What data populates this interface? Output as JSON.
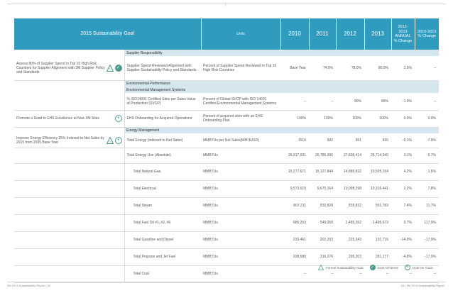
{
  "header": {
    "goal": "2015 Sustainability Goal",
    "units": "Units",
    "y2010": "2010",
    "y2011": "2011",
    "y2012": "2012",
    "y2013": "2013",
    "change1": "2012-2013 ANNUAL % Change",
    "change2": "2010-2013 % Change"
  },
  "sections": {
    "supplier": "Supplier Responsibility",
    "env": "Environmental Performance",
    "envsys": "Environmental Management Systems",
    "energy": "Energy Management"
  },
  "rows": {
    "r1": {
      "goal": "Assess 80% of Supplier Spend in Top 10 High Risk Countries for Supplier Alignment with 3M Supplier Policy and Standards",
      "metric": "Supplier Spend Reviewed Alignment with Supplier Sustainability Policy and Standards",
      "units": "Percent of Supplier Spend Reviewed in Top 10 High Risk Countries",
      "v2010": "Base Year",
      "v2011": "74.0%",
      "v2012": "78.0%",
      "v2013": "80.0%",
      "c1": "2.6%",
      "c2": "–"
    },
    "r2": {
      "metric": "% ISO14001 Certified Sites per Sales Value of Production (SVOP)",
      "units": "Percent of Global SVOP with ISO 14001 Certified Environmental Management Systems",
      "v2010": "–",
      "v2011": "–",
      "v2012": "90%",
      "v2013": "89%",
      "c1": "-1.0%",
      "c2": "–"
    },
    "r3": {
      "goal": "Promote a Road to EHS Excellence at New 3M Sites",
      "metric": "EHS Onboarding for Acquired Operations",
      "units": "Percent of acquired sites with an EHS Onboarding Plan",
      "v2010": "100%",
      "v2011": "100%",
      "v2012": "100%",
      "v2013": "100%",
      "c1": "0.0%",
      "c2": "0.0%"
    },
    "r4": {
      "goal": "Improve Energy Efficiency 25% Indexed to Net Sales by 2015 from 2005 Base Year",
      "metric": "Total Energy (Indexed to Net Sales)",
      "units": "MMBTUs per Net Sales(MM $USD)",
      "v2010": "1510",
      "v2011": "992",
      "v2012": "951",
      "v2013": "930",
      "c1": "-0.1%",
      "c2": "-7.9%"
    },
    "r5": {
      "metric": "Total Energy Use (Absolute)",
      "units": "MMBTUs",
      "v2010": "26,917,031",
      "v2011": "26,785,396",
      "v2012": "27,838,414",
      "v2013": "26,714,940",
      "c1": "3.1%",
      "c2": "6.7%"
    },
    "r6": {
      "metric": "Total Natural Gas",
      "units": "MMBTUs",
      "v2010": "15,277,671",
      "v2011": "15,127,844",
      "v2012": "14,885,822",
      "v2013": "15,505,194",
      "c1": "4.2%",
      "c2": "1.5%"
    },
    "r7": {
      "metric": "Total Electrical",
      "units": "MMBTUs",
      "v2010": "9,573,615",
      "v2011": "9,675,164",
      "v2012": "10,098,298",
      "v2013": "10,316,441",
      "c1": "2.2%",
      "c2": "7.8%"
    },
    "r8": {
      "metric": "Total Steam",
      "units": "MMBTUs",
      "v2010": "807,211",
      "v2011": "832,820",
      "v2012": "839,832",
      "v2013": "901,783",
      "c1": "7.4%",
      "c2": "11.7%"
    },
    "r9": {
      "metric": "Total Fuel Oil #1, #2, #6",
      "units": "MMBTUs",
      "v2010": "686,293",
      "v2011": "549,059",
      "v2012": "1,485,352",
      "v2013": "1,495,673",
      "c1": "0.7%",
      "c2": "117.9%"
    },
    "r10": {
      "metric": "Total Gasoline and Diesel",
      "units": "MMBTUs",
      "v2010": "233,461",
      "v2011": "202,203",
      "v2012": "225,343",
      "v2013": "191,715",
      "c1": "-14.9%",
      "c2": "-17.9%"
    },
    "r11": {
      "metric": "Total Propane and Jet Fuel",
      "units": "MMBTUs",
      "v2010": "338,680",
      "v2011": "316,276",
      "v2012": "295,203",
      "v2013": "281,177",
      "c1": "-4.8%",
      "c2": "-17.0%"
    },
    "r12": {
      "metric": "Total Coal",
      "units": "MMBTUs",
      "v2010": "–",
      "v2011": "–",
      "v2012": "–",
      "v2013": "–",
      "c1": "–",
      "c2": "–"
    }
  },
  "legend": {
    "formal": "Formal Sustainability Goal",
    "achieved": "Goal Achieved",
    "ontrack": "Goal On Track"
  },
  "footer": {
    "left": "3M 2013 Sustainability Report  |  32",
    "right": "33  |  3M 2013 Sustainability Report"
  },
  "colors": {
    "header": "#2f9bbf",
    "section": "#d5e6ee",
    "icon": "#4a9a8c"
  }
}
